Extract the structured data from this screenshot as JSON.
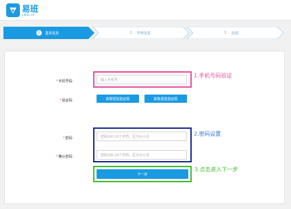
{
  "header": {
    "logo_cn": "易班",
    "logo_en": "yiban.cn"
  },
  "steps": [
    {
      "num": "1",
      "label": "基本信息",
      "active": true
    },
    {
      "num": "2",
      "label": "学校信息",
      "active": false
    },
    {
      "num": "3",
      "label": "完成",
      "active": false
    }
  ],
  "form": {
    "phone_label": "手机号码:",
    "phone_placeholder": "输入手机号",
    "code_label": "验证码:",
    "sms_code_button": "获取短信验证码",
    "voice_code_button": "获取语音验证码",
    "password_label": "密码:",
    "password_placeholder": "密码为6-16个字符，区分大小写",
    "confirm_label": "确认密码:",
    "confirm_placeholder": "密码为6-16个字符，区分大小写",
    "next_button": "下一步",
    "required_mark": "*"
  },
  "annotations": {
    "note1": "1.手机号码验证",
    "note2": "2.密码设置",
    "note3": "3.点击进入下一步"
  },
  "colors": {
    "brand": "#1a9ae1",
    "annotation_pink": "#e8509a",
    "annotation_navy": "#1a2a8f",
    "annotation_green": "#3fbf2a"
  }
}
